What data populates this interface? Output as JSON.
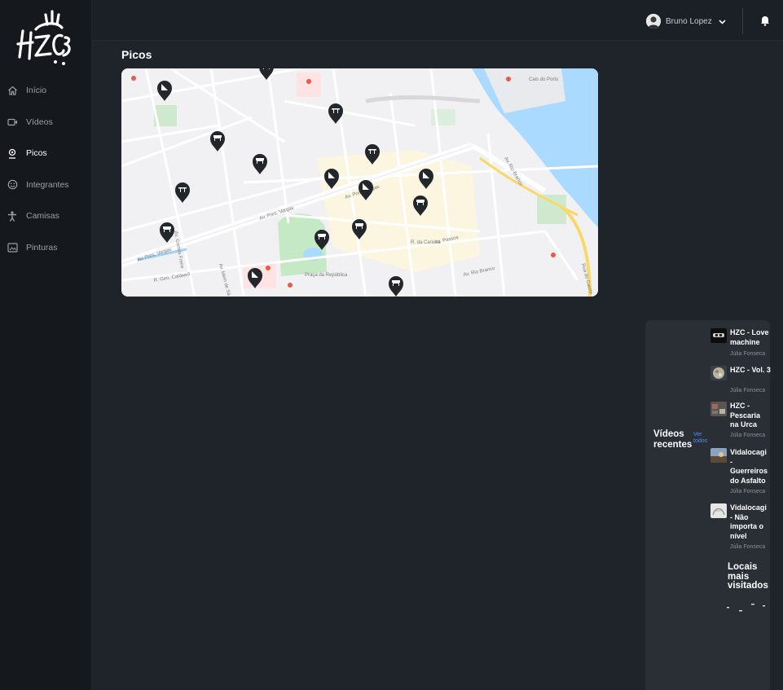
{
  "brand": {
    "logo_text": "HZC"
  },
  "sidebar": {
    "items": [
      {
        "label": "Início",
        "icon": "home-icon"
      },
      {
        "label": "Vídeos",
        "icon": "video-camera-icon"
      },
      {
        "label": "Picos",
        "icon": "map-pin-icon",
        "active": true
      },
      {
        "label": "Integrantes",
        "icon": "smile-icon"
      },
      {
        "label": "Camisas",
        "icon": "person-icon"
      },
      {
        "label": "Pinturas",
        "icon": "image-icon"
      }
    ]
  },
  "header": {
    "user_name": "Bruno Lopez",
    "avatar_icon": "avatar-icon",
    "dropdown_icon": "chevron-down-icon",
    "notification_icon": "bell-icon"
  },
  "main": {
    "title": "Picos",
    "map": {
      "street_labels": [
        "Av. Pres. Vargas",
        "Av. Pres. Vargas",
        "Av. Rio Branco",
        "Av. Passos",
        "R. da Carioca",
        "Av. Pres. Vargas",
        "Praça da República",
        "R. Gen. Caldwell",
        "Av. Mem de Sá",
        "Av. Rio Branco",
        "Rua do Catete",
        "Av. Gomes Freire",
        "Cais do Porto"
      ],
      "marker_count": 16
    }
  },
  "right_panel": {
    "recent_videos_title": "Vídeos recentes",
    "see_all_label": "Ver todos",
    "videos": [
      {
        "title": "HZC - Love machine",
        "author": "Júlia Fonseca"
      },
      {
        "title": "HZC - Vol. 3",
        "author": "Júlia Fonseca"
      },
      {
        "title": "HZC - Pescaria na Urca",
        "author": "Júlia Fonseca"
      },
      {
        "title": "Vidalocagi - Guerreiros do Asfalto",
        "author": "Júlia Fonseca"
      },
      {
        "title": "Vidalocagi - Não importa o nível",
        "author": "Júlia Fonseca"
      }
    ],
    "places_title": "Locais mais visitados"
  },
  "colors": {
    "background": "#1f242b",
    "sidebar": "#15181c",
    "panel": "#2a2f36",
    "link": "#4c8dff",
    "water": "#aadaff",
    "park": "#c5e8c5"
  }
}
